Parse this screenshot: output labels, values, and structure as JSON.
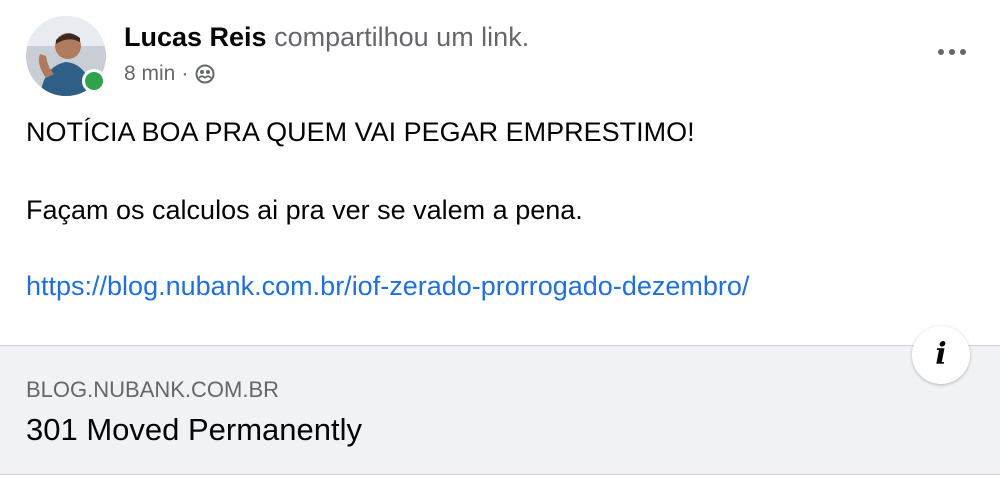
{
  "post": {
    "author": {
      "name": "Lucas Reis",
      "action": "compartilhou um link.",
      "online": true,
      "avatar_icon": "user-avatar"
    },
    "meta": {
      "time": "8 min",
      "separator": "·",
      "audience_icon": "friends-icon"
    },
    "more_icon": "more-horizontal-icon",
    "body": {
      "line1": "NOTÍCIA BOA PRA QUEM VAI PEGAR EMPRESTIMO!",
      "line2": "Façam os calculos ai pra ver se valem a pena.",
      "link": "https://blog.nubank.com.br/iof-zerado-prorrogado-dezembro/"
    },
    "link_preview": {
      "domain": "BLOG.NUBANK.COM.BR",
      "title": "301 Moved Permanently",
      "info_icon": "i"
    }
  },
  "colors": {
    "primary_text": "#050505",
    "secondary_text": "#65676b",
    "link": "#216fdb",
    "preview_bg": "#f0f2f5",
    "online": "#31a24c"
  }
}
